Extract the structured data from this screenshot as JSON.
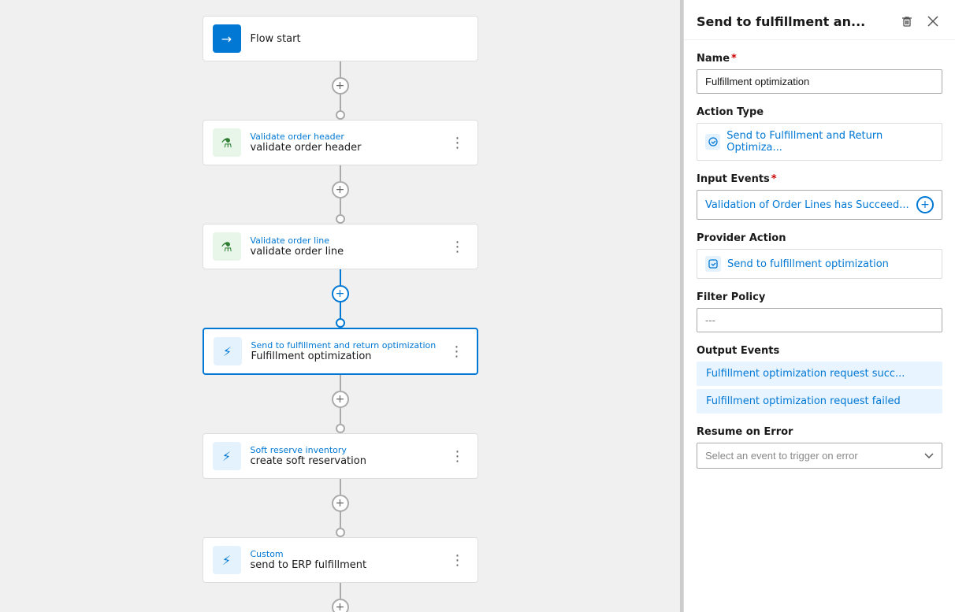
{
  "canvas": {
    "nodes": [
      {
        "id": "flow-start",
        "type_label": "",
        "name": "Flow start",
        "icon_type": "blue-icon",
        "icon": "→",
        "selected": false
      },
      {
        "id": "validate-header",
        "type_label": "Validate order header",
        "name": "validate order header",
        "icon_type": "green-icon",
        "icon": "⚗",
        "selected": false
      },
      {
        "id": "validate-line",
        "type_label": "Validate order line",
        "name": "validate order line",
        "icon_type": "green-icon",
        "icon": "⚗",
        "selected": false
      },
      {
        "id": "fulfillment-opt",
        "type_label": "Send to fulfillment and return optimization",
        "name": "Fulfillment optimization",
        "icon_type": "light-blue-icon",
        "icon": "⚡",
        "selected": true
      },
      {
        "id": "soft-reserve",
        "type_label": "Soft reserve inventory",
        "name": "create soft reservation",
        "icon_type": "light-blue-icon",
        "icon": "⚡",
        "selected": false
      },
      {
        "id": "custom-erp",
        "type_label": "Custom",
        "name": "send to ERP fulfillment",
        "icon_type": "light-blue-icon",
        "icon": "⚡",
        "selected": false
      }
    ],
    "connectors": {
      "plus_label": "+",
      "circle_label": "○"
    }
  },
  "panel": {
    "title": "Send to fulfillment an...",
    "delete_tooltip": "Delete",
    "close_tooltip": "Close",
    "name_label": "Name",
    "name_required": true,
    "name_value": "Fulfillment optimization",
    "action_type_label": "Action Type",
    "action_type_text": "Send to Fulfillment and Return Optimiza...",
    "input_events_label": "Input Events",
    "input_events_required": true,
    "input_events_text": "Validation of Order Lines has Succeed...",
    "provider_action_label": "Provider Action",
    "provider_action_text": "Send to fulfillment optimization",
    "filter_policy_label": "Filter Policy",
    "filter_policy_placeholder": "---",
    "output_events_label": "Output Events",
    "output_events": [
      "Fulfillment optimization request succ...",
      "Fulfillment optimization request failed"
    ],
    "resume_on_error_label": "Resume on Error",
    "resume_on_error_placeholder": "Select an event to trigger on error"
  }
}
